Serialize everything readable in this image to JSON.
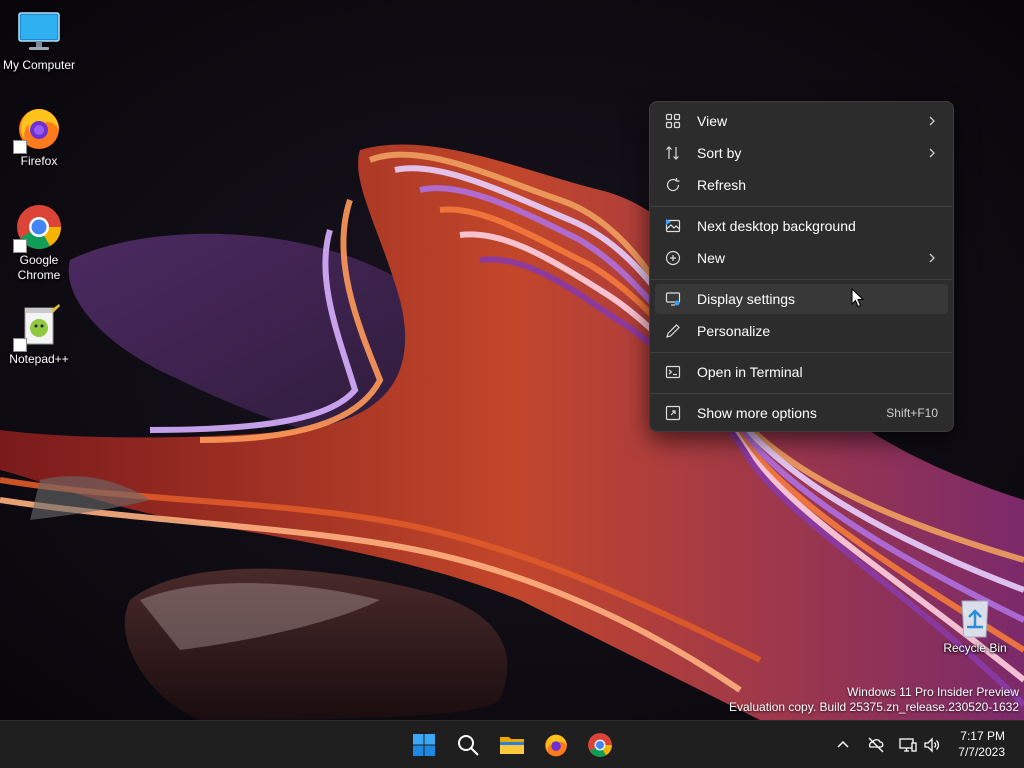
{
  "desktop": {
    "icons": [
      {
        "label": "My Computer",
        "icon": "monitor-icon"
      },
      {
        "label": "Firefox",
        "icon": "firefox-icon"
      },
      {
        "label": "Google\nChrome",
        "icon": "chrome-icon"
      },
      {
        "label": "Notepad++",
        "icon": "notepadpp-icon"
      },
      {
        "label": "Recycle Bin",
        "icon": "recycle-bin-icon"
      }
    ]
  },
  "context_menu": {
    "items": [
      {
        "label": "View",
        "icon": "grid-icon",
        "submenu": true
      },
      {
        "label": "Sort by",
        "icon": "sort-icon",
        "submenu": true
      },
      {
        "label": "Refresh",
        "icon": "refresh-icon"
      },
      {
        "label": "Next desktop background",
        "icon": "next-background-icon"
      },
      {
        "label": "New",
        "icon": "plus-circle-icon",
        "submenu": true
      },
      {
        "label": "Display settings",
        "icon": "display-settings-icon",
        "hovered": true
      },
      {
        "label": "Personalize",
        "icon": "pen-icon"
      },
      {
        "label": "Open in Terminal",
        "icon": "terminal-icon"
      },
      {
        "label": "Show more options",
        "icon": "show-more-icon",
        "shortcut": "Shift+F10"
      }
    ]
  },
  "watermark": {
    "line1": "Windows 11 Pro Insider Preview",
    "line2": "Evaluation copy. Build 25375.zn_release.230520-1632"
  },
  "taskbar": {
    "apps": [
      "start-icon",
      "search-icon",
      "file-explorer-icon",
      "firefox-icon",
      "chrome-icon"
    ],
    "tray": [
      "chevron-up-icon",
      "network-offline-icon",
      "display-icon",
      "volume-icon"
    ],
    "time": "7:17 PM",
    "date": "7/7/2023"
  },
  "colors": {
    "menu_bg": "#2c2c2c",
    "taskbar_bg": "#1f1f1f",
    "accent": "#0078d4"
  }
}
